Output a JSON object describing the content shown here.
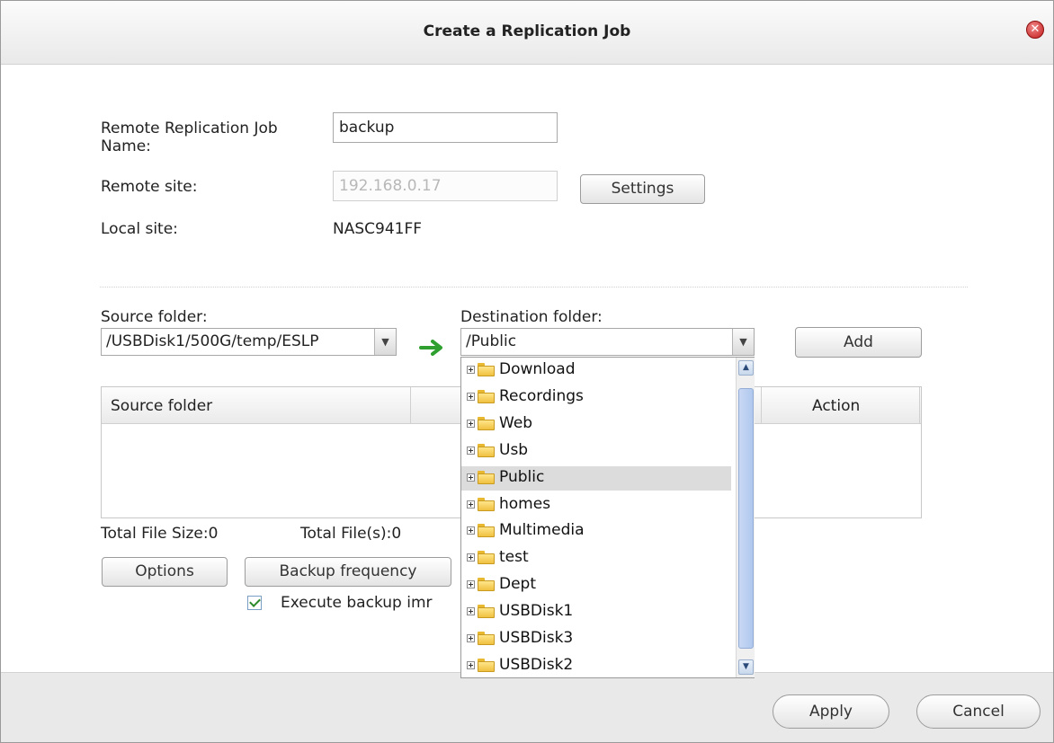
{
  "dialog": {
    "title": "Create a Replication Job",
    "close_icon": "close-icon"
  },
  "form": {
    "job_name_label_line1": "Remote Replication Job",
    "job_name_label_line2": "Name:",
    "job_name_value": "backup",
    "remote_site_label": "Remote site:",
    "remote_site_value": "192.168.0.17",
    "settings_button": "Settings",
    "local_site_label": "Local site:",
    "local_site_value": "NASC941FF"
  },
  "folders": {
    "source_label": "Source folder:",
    "source_value": "/USBDisk1/500G/temp/ESLP",
    "destination_label": "Destination folder:",
    "destination_value": "/Public",
    "add_button": "Add",
    "arrow_icon": "arrow-right-icon"
  },
  "table": {
    "columns": [
      "Source folder",
      "Action"
    ]
  },
  "totals": {
    "file_size": "Total File Size:0",
    "files": "Total File(s):0"
  },
  "buttons": {
    "options": "Options",
    "backup_frequency": "Backup frequency",
    "execute_label": "Execute backup imr",
    "execute_checked": true
  },
  "dropdown": {
    "items": [
      "Download",
      "Recordings",
      "Web",
      "Usb",
      "Public",
      "homes",
      "Multimedia",
      "test",
      "Dept",
      "USBDisk1",
      "USBDisk3",
      "USBDisk2"
    ],
    "selected": "Public"
  },
  "footer": {
    "apply": "Apply",
    "cancel": "Cancel"
  },
  "colors": {
    "accent_green": "#2fa02f",
    "close_red": "#c41a1a"
  }
}
